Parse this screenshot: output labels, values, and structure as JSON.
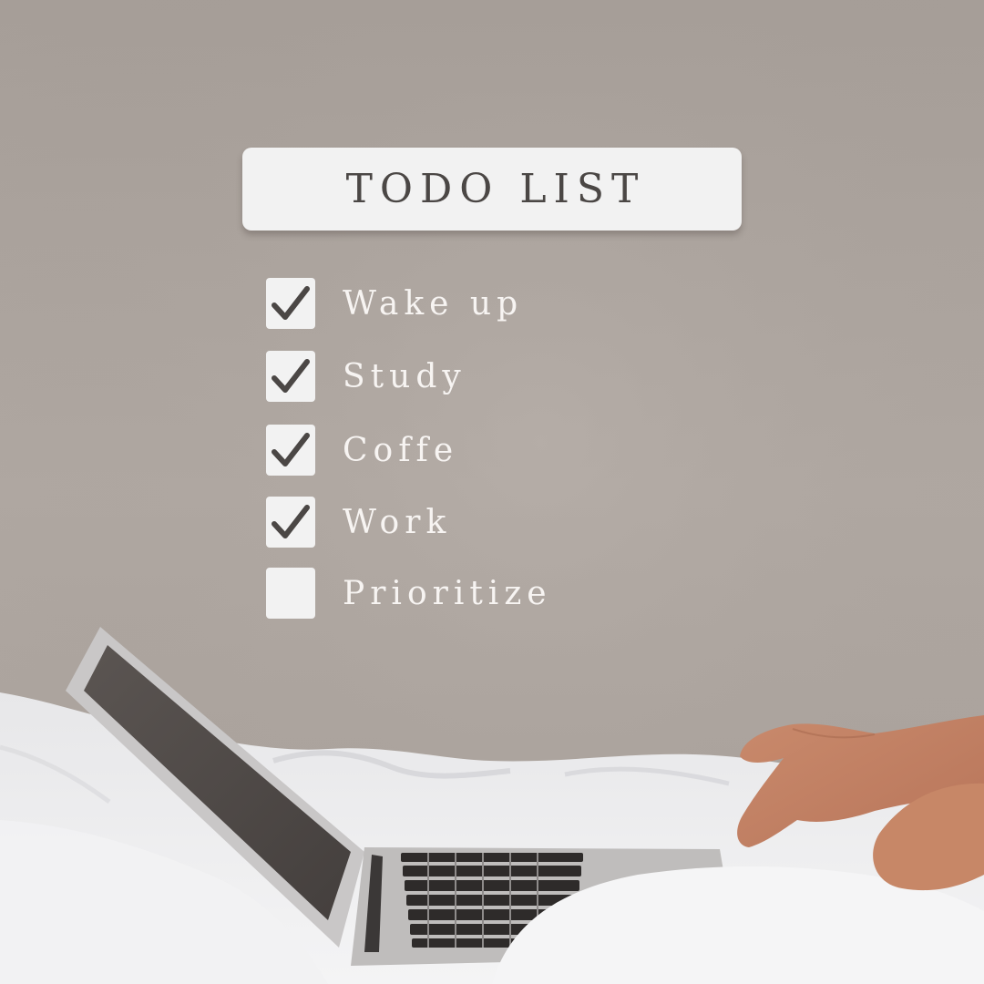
{
  "title": "TODO LIST",
  "items": [
    {
      "label": "Wake up",
      "checked": true
    },
    {
      "label": "Study",
      "checked": true
    },
    {
      "label": "Coffe",
      "checked": true
    },
    {
      "label": "Work",
      "checked": true
    },
    {
      "label": "Prioritize",
      "checked": false
    }
  ],
  "colors": {
    "background": "#ada59f",
    "card": "#f2f2f2",
    "title_text": "#4b4745",
    "checkmark": "#4b4745",
    "item_text": "#f7f4f2"
  }
}
